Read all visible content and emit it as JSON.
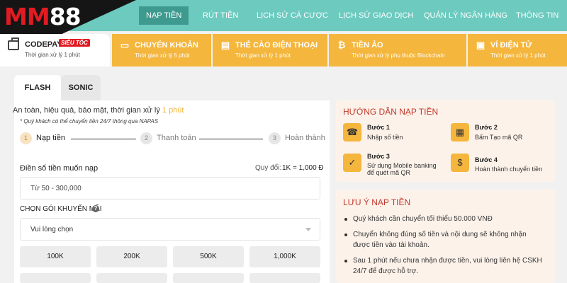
{
  "brand": {
    "logo_red": "MM",
    "logo_white": "88",
    "logo_color": "#e11b22"
  },
  "nav": {
    "items": [
      {
        "label": "NẠP TIỀN",
        "active": true
      },
      {
        "label": "RÚT TIỀN"
      },
      {
        "label": "LỊCH SỬ CÁ CƯỢC"
      },
      {
        "label": "LỊCH SỬ GIAO DỊCH"
      },
      {
        "label": "QUẢN LÝ NGÂN HÀNG"
      },
      {
        "label": "THÔNG TIN"
      }
    ],
    "bar_color": "#6ccabf",
    "active_color": "#3e9a8f"
  },
  "methods": {
    "codepay": {
      "name": "CODEPAY",
      "badge": "SIÊU TỐC",
      "subtitle": "Thời gian xử lý 1 phút"
    },
    "items": [
      {
        "name": "CHUYỂN KHOẢN",
        "subtitle": "Thời gian xử lý 5 phút",
        "icon": "card-icon"
      },
      {
        "name": "THẺ CÀO ĐIỆN THOẠI",
        "subtitle": "Thời gian xử lý 1 phút",
        "icon": "phone-card-icon"
      },
      {
        "name": "TIỀN ẢO",
        "subtitle": "Thời gian xử lý phụ thuộc Blockchain",
        "icon": "bitcoin-icon"
      },
      {
        "name": "VÍ ĐIỆN TỬ",
        "subtitle": "Thời gian xử lý 1 phút",
        "icon": "wallet-icon"
      }
    ],
    "accent": "#f4b63d"
  },
  "tabs": [
    {
      "label": "FLASH",
      "active": true
    },
    {
      "label": "SONIC"
    }
  ],
  "form": {
    "intro_text": "An toàn, hiệu quả, bảo mật, thời gian xử lý",
    "intro_highlight": "1 phút",
    "note": "* Quý khách có thể chuyển tiền 24/7 thông qua NAPAS",
    "steps": [
      {
        "num": "1",
        "label": "Nạp tiền",
        "active": true
      },
      {
        "num": "2",
        "label": "Thanh toán"
      },
      {
        "num": "3",
        "label": "Hoàn thành"
      }
    ],
    "amount_label": "Điền số tiền muốn nạp",
    "conversion_label": "Quy đổi:",
    "conversion_value": "1K = 1,000 Đ",
    "amount_placeholder": "Từ 50 - 300,000",
    "promo_label": "CHỌN GÓI KHUYẾN MÃI",
    "promo_value": "Vui lòng chọn",
    "quick_amounts": [
      "100K",
      "200K",
      "500K",
      "1,000K"
    ]
  },
  "guide": {
    "title": "HƯỚNG DẪN NẠP TIỀN",
    "steps": [
      {
        "title": "Bước 1",
        "desc": [
          "Nhập số tiền"
        ]
      },
      {
        "title": "Bước 2",
        "desc": [
          "Bấm Tạo mã QR"
        ]
      },
      {
        "title": "Bước 3",
        "desc": [
          "Sử dụng Mobile banking",
          "để quét mã QR"
        ]
      },
      {
        "title": "Bước 4",
        "desc": [
          "Hoàn thành chuyển tiền"
        ]
      }
    ]
  },
  "notes": {
    "title": "LƯU Ý NẠP TIỀN",
    "items": [
      "Quý khách cần chuyển tối thiểu 50.000 VNĐ",
      "Chuyển không đúng số tiền và nội dung sẽ không nhận được tiền vào tài khoản.",
      "Sau 1 phút nếu chưa nhận được tiền, vui lòng liên hệ CSKH 24/7 để được hỗ trợ."
    ]
  }
}
